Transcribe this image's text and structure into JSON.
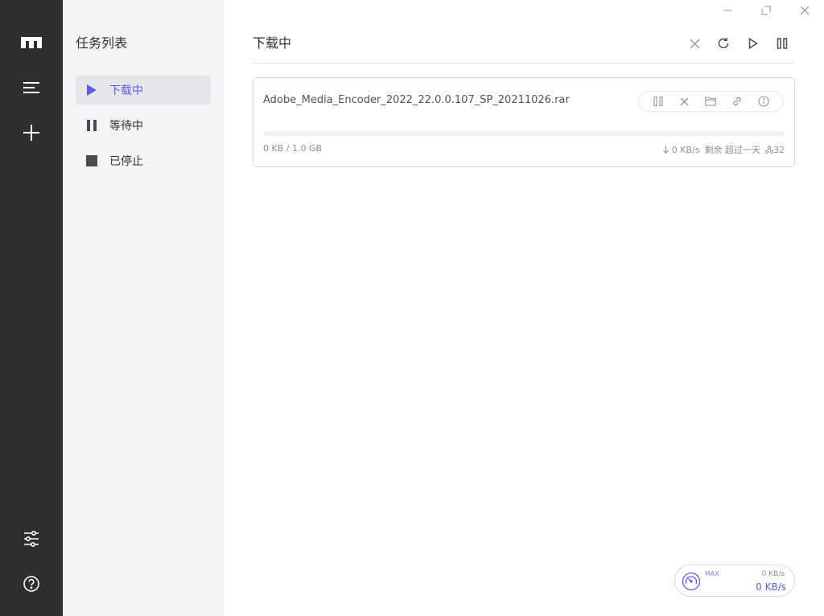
{
  "rail": {
    "items": [
      "logo-icon",
      "menu-icon",
      "add-icon",
      "settings-sliders-icon",
      "help-icon"
    ]
  },
  "sidebar": {
    "title": "任务列表",
    "items": [
      {
        "label": "下载中",
        "icon": "play-icon",
        "active": true
      },
      {
        "label": "等待中",
        "icon": "pause-icon",
        "active": false
      },
      {
        "label": "已停止",
        "icon": "stop-icon",
        "active": false
      }
    ]
  },
  "window_controls": [
    "minimize-icon",
    "maximize-icon",
    "close-icon"
  ],
  "main": {
    "title": "下载中",
    "toolbar": [
      "delete-icon",
      "refresh-icon",
      "resume-all-icon",
      "pause-all-icon"
    ]
  },
  "task": {
    "name": "Adobe_Media_Encoder_2022_22.0.0.107_SP_20211026.rar",
    "size": "0 KB / 1.0 GB",
    "progress": 0,
    "speed": "0 KB/s",
    "remaining": "剩余 超过一天",
    "connections": "32",
    "actions": [
      "pause-icon",
      "delete-icon",
      "folder-icon",
      "link-icon",
      "info-icon"
    ]
  },
  "speedometer": {
    "max_label": "MAX",
    "upload": "0 KB/s",
    "download": "0 KB/s"
  },
  "colors": {
    "accent": "#5b5bea",
    "rail_bg": "#2e2e30",
    "sidebar_bg": "#f3f4f6"
  }
}
